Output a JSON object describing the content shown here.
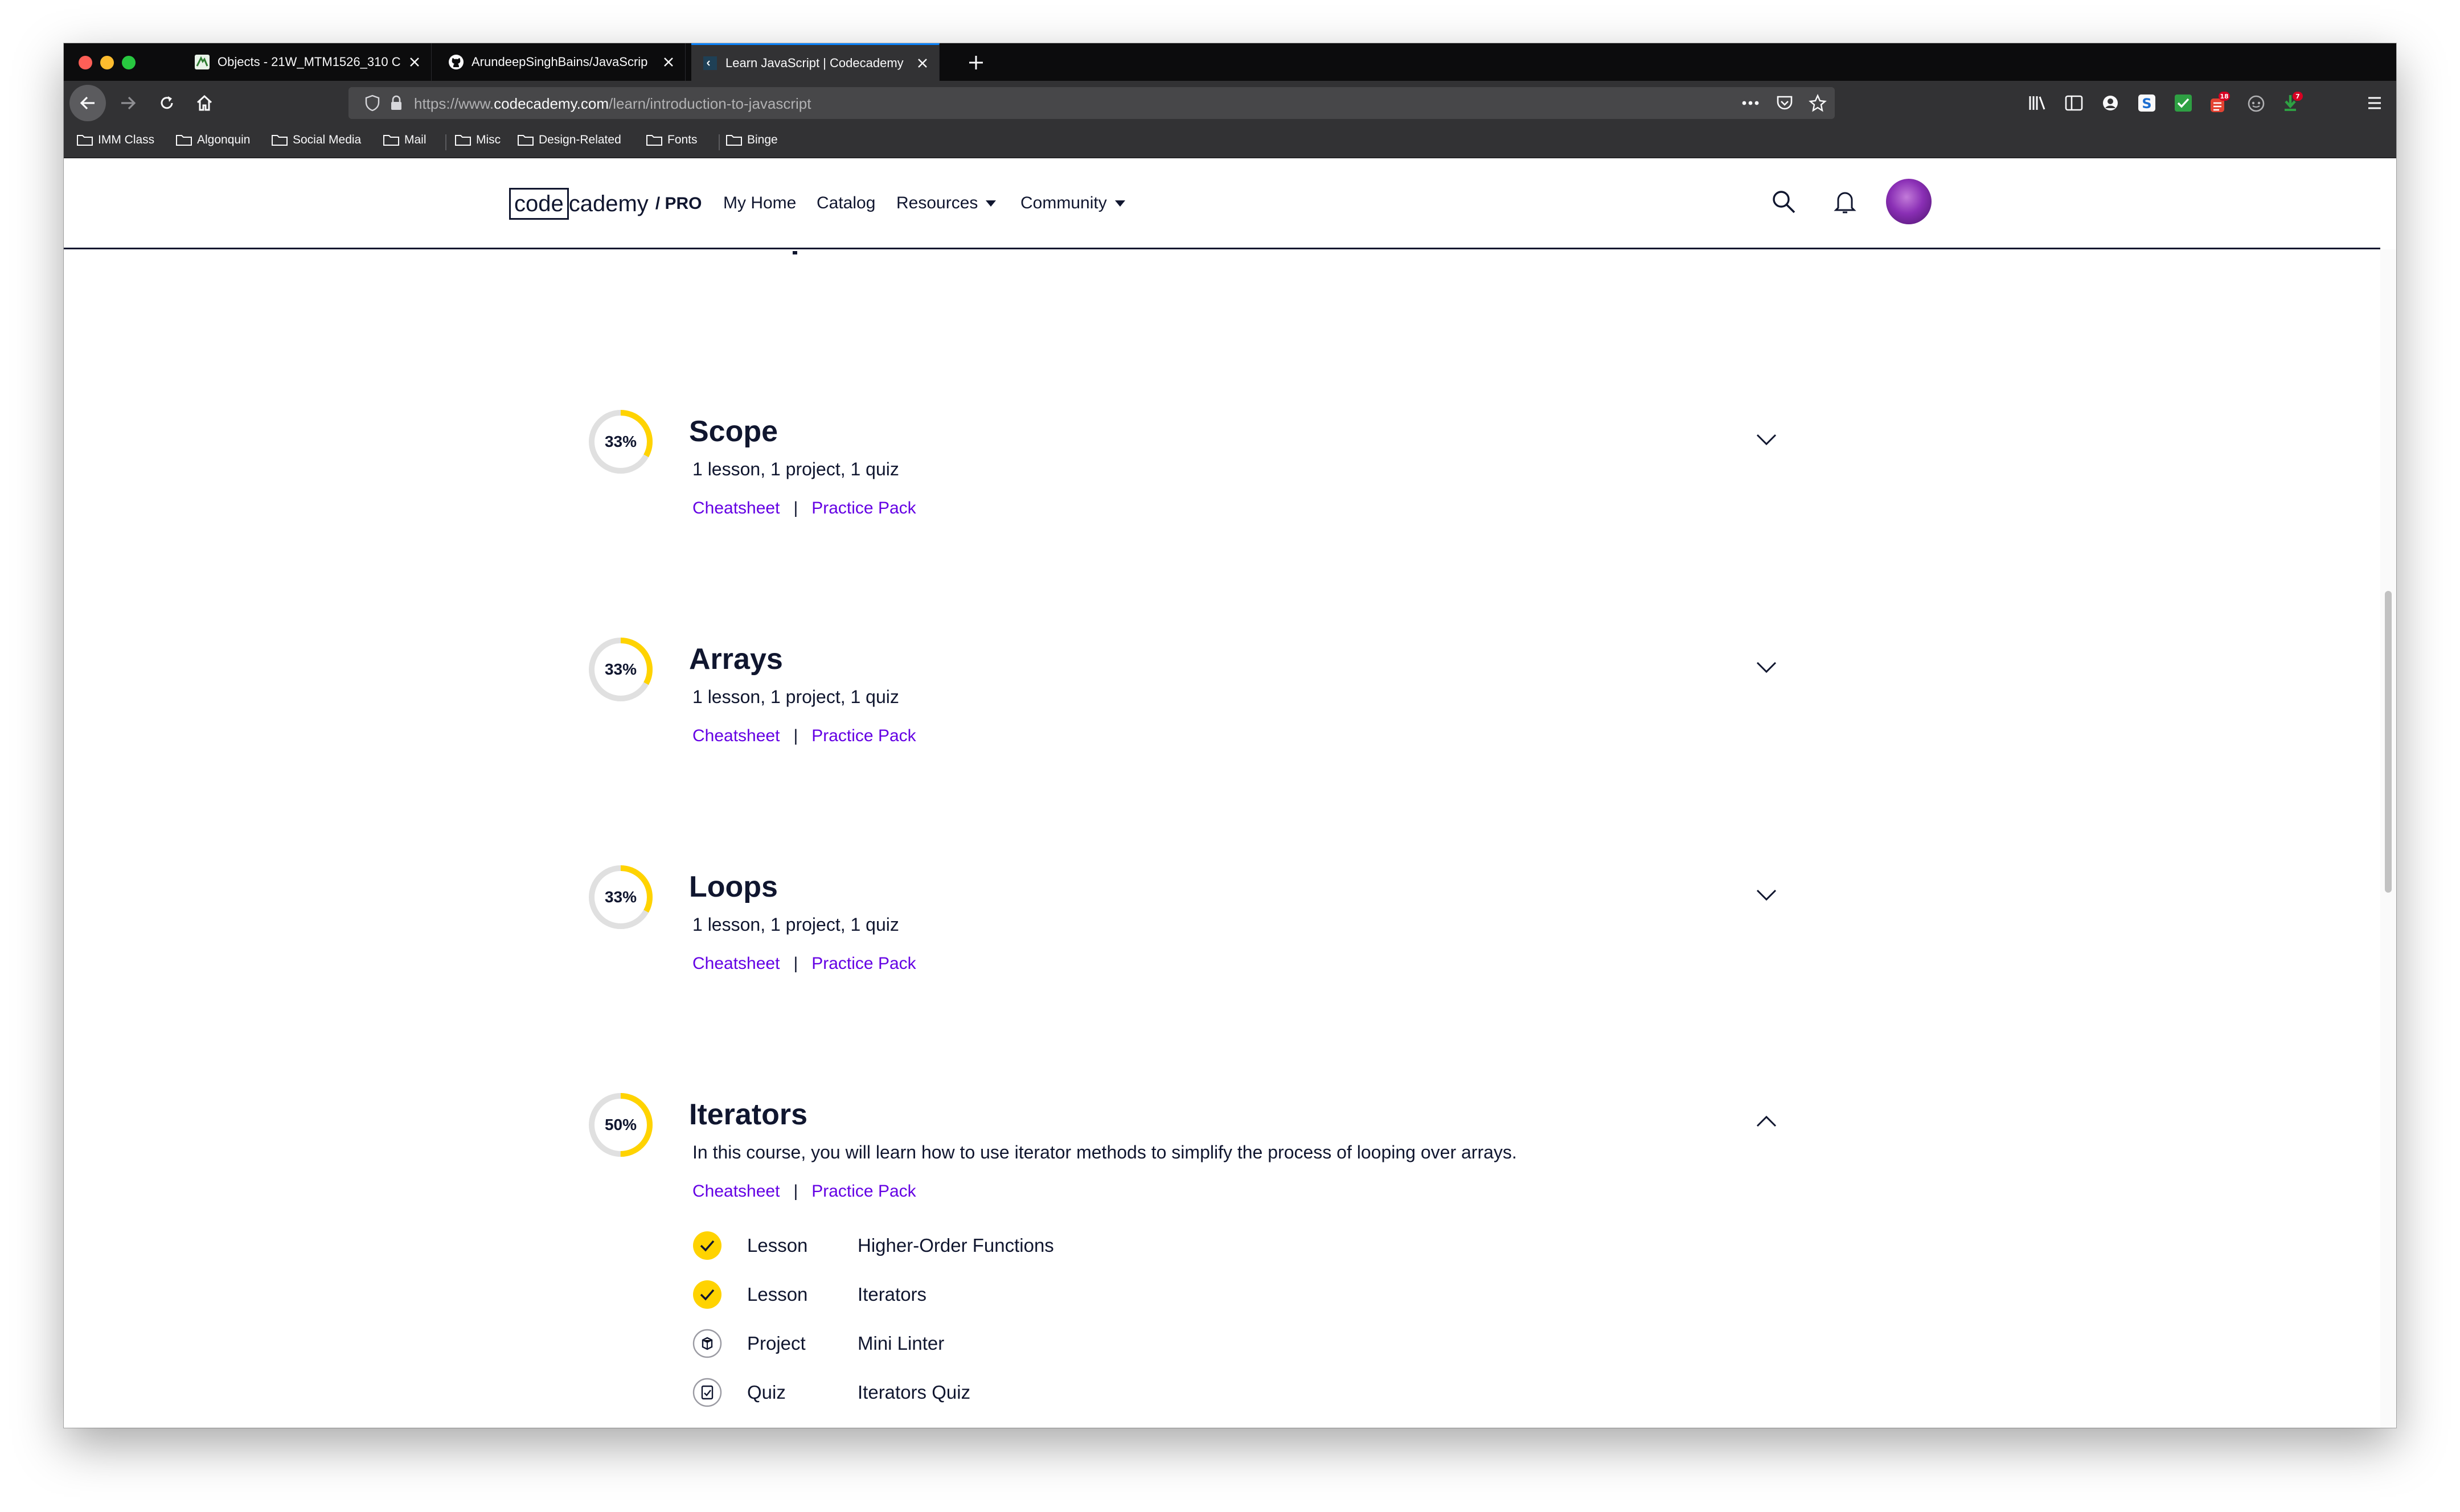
{
  "browser": {
    "tabs": [
      {
        "label": "Objects - 21W_MTM1526_310 C",
        "favicon": "algonquin-favicon-icon",
        "active": false
      },
      {
        "label": "ArundeepSinghBains/JavaScrip",
        "favicon": "github-icon",
        "active": false
      },
      {
        "label": "Learn JavaScript | Codecademy",
        "favicon": "codecademy-favicon-icon",
        "active": true
      }
    ],
    "url_prefix": "https://www.",
    "url_domain": "codecademy.com",
    "url_path": "/learn/introduction-to-javascript",
    "badges": {
      "todoist": "18",
      "download": "7"
    },
    "bookmarks": [
      "IMM Class",
      "Algonquin",
      "Social Media",
      "Mail",
      "Misc",
      "Design-Related",
      "Fonts",
      "Binge"
    ]
  },
  "header": {
    "logo_code": "code",
    "logo_cademy": "cademy",
    "logo_pro": "/ PRO",
    "nav": [
      "My Home",
      "Catalog",
      "Resources",
      "Community"
    ]
  },
  "modules": [
    {
      "percent": "33%",
      "progress": 0.33,
      "title": "Scope",
      "description": "1 lesson, 1 project, 1 quiz",
      "cheatsheet": "Cheatsheet",
      "practice": "Practice Pack",
      "expanded": false
    },
    {
      "percent": "33%",
      "progress": 0.33,
      "title": "Arrays",
      "description": "1 lesson, 1 project, 1 quiz",
      "cheatsheet": "Cheatsheet",
      "practice": "Practice Pack",
      "expanded": false
    },
    {
      "percent": "33%",
      "progress": 0.33,
      "title": "Loops",
      "description": "1 lesson, 1 project, 1 quiz",
      "cheatsheet": "Cheatsheet",
      "practice": "Practice Pack",
      "expanded": false
    },
    {
      "percent": "50%",
      "progress": 0.5,
      "title": "Iterators",
      "description": "In this course, you will learn how to use iterator methods to simplify the process of looping over arrays.",
      "cheatsheet": "Cheatsheet",
      "practice": "Practice Pack",
      "expanded": true,
      "items": [
        {
          "type": "Lesson",
          "name": "Higher-Order Functions",
          "status": "complete"
        },
        {
          "type": "Lesson",
          "name": "Iterators",
          "status": "complete"
        },
        {
          "type": "Project",
          "name": "Mini Linter",
          "status": "project"
        },
        {
          "type": "Quiz",
          "name": "Iterators Quiz",
          "status": "quiz"
        }
      ]
    }
  ],
  "colors": {
    "progress_fill": "#ffd300",
    "progress_track": "#e0e0e0",
    "link": "#6400e4",
    "text": "#10162f"
  }
}
